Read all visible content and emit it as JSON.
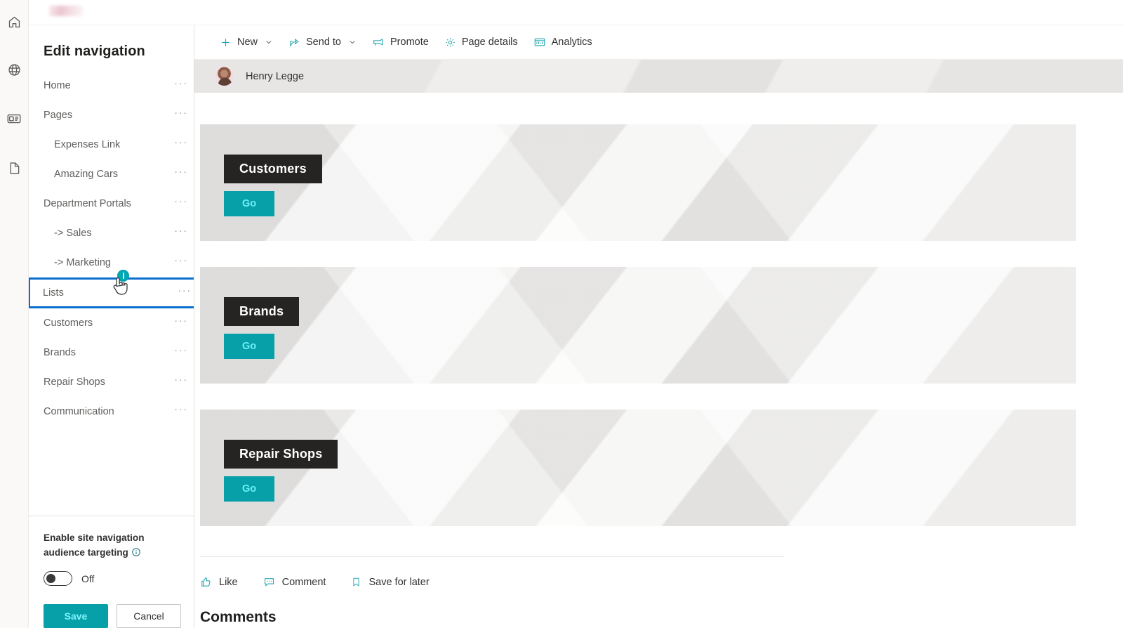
{
  "rail": {
    "items": [
      {
        "name": "home-icon",
        "label": "Home"
      },
      {
        "name": "globe-icon",
        "label": "Sites"
      },
      {
        "name": "news-icon",
        "label": "News"
      },
      {
        "name": "document-icon",
        "label": "Files"
      }
    ]
  },
  "brand": {
    "logo_alt": "Site logo"
  },
  "panel": {
    "title": "Edit navigation",
    "items": [
      {
        "label": "Home",
        "level": 0,
        "focused": false
      },
      {
        "label": "Pages",
        "level": 0,
        "focused": false
      },
      {
        "label": "Expenses Link",
        "level": 1,
        "focused": false
      },
      {
        "label": "Amazing Cars",
        "level": 1,
        "focused": false
      },
      {
        "label": "Department Portals",
        "level": 0,
        "focused": false
      },
      {
        "label": "-> Sales",
        "level": 1,
        "focused": false
      },
      {
        "label": "-> Marketing",
        "level": 1,
        "focused": false
      },
      {
        "label": "Lists",
        "level": 0,
        "focused": true
      },
      {
        "label": "Customers",
        "level": 0,
        "focused": false
      },
      {
        "label": "Brands",
        "level": 0,
        "focused": false
      },
      {
        "label": "Repair Shops",
        "level": 0,
        "focused": false
      },
      {
        "label": "Communication",
        "level": 0,
        "focused": false
      }
    ],
    "overflow_glyph": "···",
    "footer": {
      "audience_label": "Enable site navigation audience targeting",
      "info_icon": "info-icon",
      "toggle_state": "Off",
      "toggle_on": false,
      "save_label": "Save",
      "cancel_label": "Cancel"
    }
  },
  "commandbar": {
    "items": [
      {
        "label": "New",
        "icon": "add-icon",
        "chevron": true
      },
      {
        "label": "Send to",
        "icon": "send-to-icon",
        "chevron": true
      },
      {
        "label": "Promote",
        "icon": "promote-icon",
        "chevron": false
      },
      {
        "label": "Page details",
        "icon": "gear-icon",
        "chevron": false
      },
      {
        "label": "Analytics",
        "icon": "analytics-icon",
        "chevron": false
      }
    ]
  },
  "page": {
    "byline": {
      "author": "Henry Legge",
      "avatar": "author-avatar"
    },
    "heroes": [
      {
        "title": "Customers",
        "cta": "Go"
      },
      {
        "title": "Brands",
        "cta": "Go"
      },
      {
        "title": "Repair Shops",
        "cta": "Go"
      }
    ],
    "social": [
      {
        "label": "Like",
        "icon": "thumbs-up-icon"
      },
      {
        "label": "Comment",
        "icon": "comment-icon"
      },
      {
        "label": "Save for later",
        "icon": "bookmark-icon"
      }
    ],
    "comments_heading": "Comments"
  },
  "colors": {
    "accent_teal": "#07a0a8",
    "cta_text": "#6cf0f8",
    "focus_blue": "#0a6ed1",
    "title_block": "#252423",
    "hero_bg": "#f2f1f0"
  }
}
